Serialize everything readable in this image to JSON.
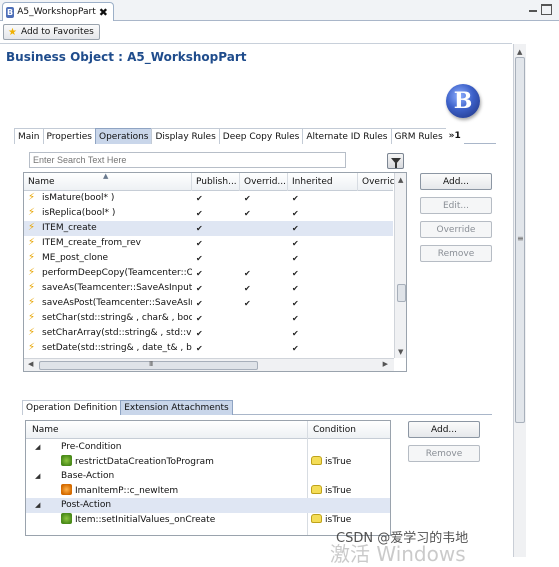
{
  "editor_tab": {
    "title": "A5_WorkshopPart",
    "close_glyph": "✖"
  },
  "toolbar": {
    "favorites_label": "Add to Favorites"
  },
  "header": {
    "title": "Business Object : A5_WorkshopPart",
    "badge_letter": "B"
  },
  "tabs": [
    {
      "label": "Main",
      "active": false
    },
    {
      "label": "Properties",
      "active": false
    },
    {
      "label": "Operations",
      "active": true
    },
    {
      "label": "Display Rules",
      "active": false
    },
    {
      "label": "Deep Copy Rules",
      "active": false
    },
    {
      "label": "Alternate ID Rules",
      "active": false
    },
    {
      "label": "GRM Rules",
      "active": false
    },
    {
      "label": "»1",
      "active": false
    }
  ],
  "search": {
    "placeholder": "Enter Search Text Here"
  },
  "operations": {
    "columns": [
      "Name",
      "Publish...",
      "Overrid...",
      "Inherited",
      "Overric"
    ],
    "rows": [
      {
        "name": "isMature(bool* )",
        "published": true,
        "overridable": true,
        "inherited": true,
        "selected": false
      },
      {
        "name": "isReplica(bool* )",
        "published": true,
        "overridable": true,
        "inherited": true,
        "selected": false
      },
      {
        "name": "ITEM_create",
        "published": true,
        "overridable": false,
        "inherited": true,
        "selected": true
      },
      {
        "name": "ITEM_create_from_rev",
        "published": true,
        "overridable": false,
        "inherited": true,
        "selected": false
      },
      {
        "name": "ME_post_clone",
        "published": true,
        "overridable": false,
        "inherited": true,
        "selected": false
      },
      {
        "name": "performDeepCopy(Teamcenter::Op",
        "published": true,
        "overridable": true,
        "inherited": true,
        "selected": false
      },
      {
        "name": "saveAs(Teamcenter::SaveAsInput*,",
        "published": true,
        "overridable": true,
        "inherited": true,
        "selected": false
      },
      {
        "name": "saveAsPost(Teamcenter::SaveAsInpu",
        "published": true,
        "overridable": true,
        "inherited": true,
        "selected": false
      },
      {
        "name": "setChar(std::string& , char& , bool )",
        "published": true,
        "overridable": false,
        "inherited": true,
        "selected": false
      },
      {
        "name": "setCharArray(std::string& , std::vect",
        "published": true,
        "overridable": false,
        "inherited": true,
        "selected": false
      },
      {
        "name": "setDate(std::string& , date_t& , bool",
        "published": true,
        "overridable": false,
        "inherited": true,
        "selected": false
      }
    ],
    "hscroll_grip": "III"
  },
  "op_buttons": {
    "add": "Add...",
    "edit": "Edit...",
    "override": "Override",
    "remove": "Remove"
  },
  "bottom_tabs": [
    {
      "label": "Operation Definition",
      "active": false
    },
    {
      "label": "Extension Attachments",
      "active": true
    }
  ],
  "extensions": {
    "columns": [
      "Name",
      "Condition"
    ],
    "rows": [
      {
        "kind": "group",
        "label": "Pre-Condition",
        "selected": false
      },
      {
        "kind": "rule",
        "label": "restrictDataCreationToProgram",
        "condition": "isTrue",
        "icon": "green-rule-icon"
      },
      {
        "kind": "group",
        "label": "Base-Action",
        "selected": false
      },
      {
        "kind": "rule",
        "label": "ImanItemP::c_newItem",
        "condition": "isTrue",
        "icon": "orange-rule-icon"
      },
      {
        "kind": "group",
        "label": "Post-Action",
        "selected": true
      },
      {
        "kind": "rule",
        "label": "Item::setInitialValues_onCreate",
        "condition": "isTrue",
        "icon": "condition-icon"
      }
    ]
  },
  "ext_buttons": {
    "add": "Add...",
    "remove": "Remove"
  },
  "watermark": {
    "line1": "CSDN @爱学习的韦地",
    "line2": "激活 Windows"
  },
  "glyphs": {
    "check": "✔",
    "collapse": "◢",
    "op": "⚡"
  },
  "colors": {
    "title": "#1f4c8c",
    "active_tab": "#c9d6ea",
    "selection": "#dfe6f3"
  }
}
